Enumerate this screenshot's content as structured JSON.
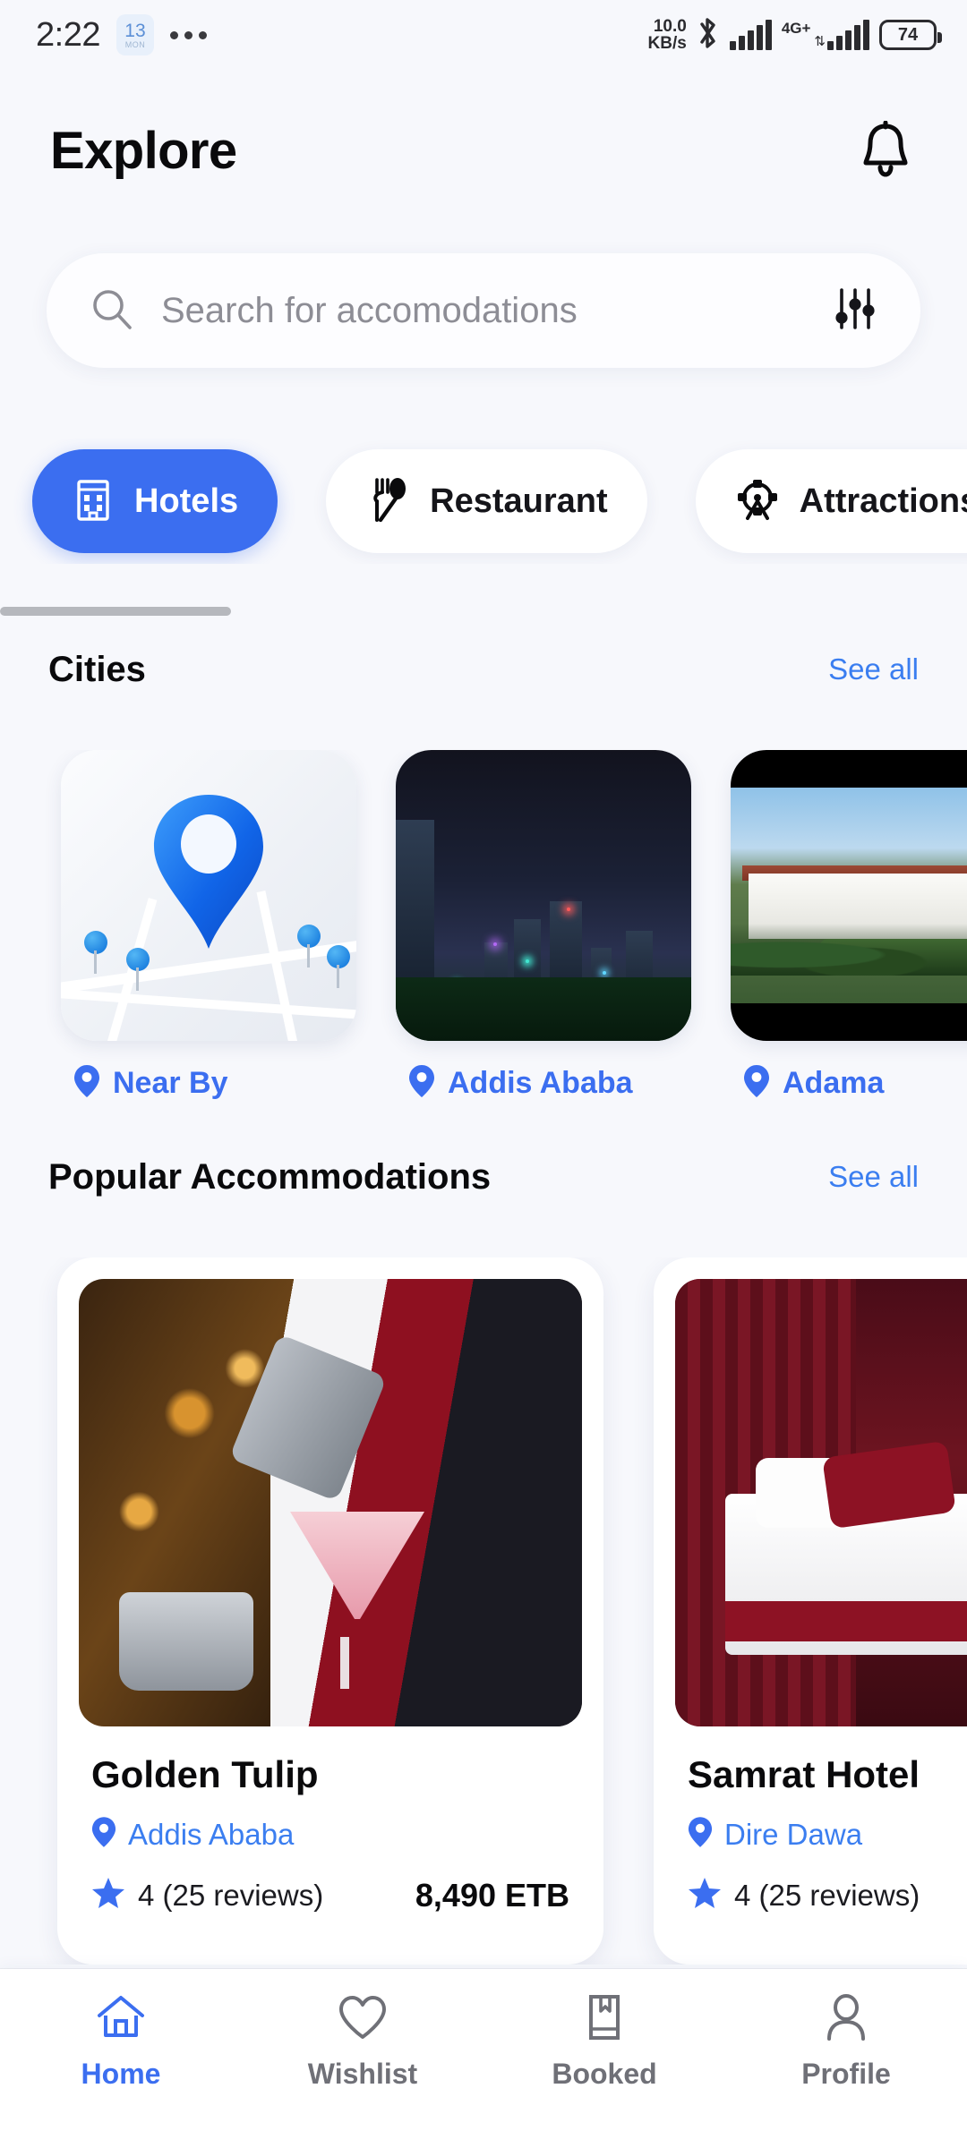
{
  "statusbar": {
    "time": "2:22",
    "calendar_day": "13",
    "calendar_weekday": "MON",
    "network_speed": "10.0",
    "network_speed_unit": "KB/s",
    "network_type": "4G+",
    "battery_level": "74",
    "bluetooth_icon": "bluetooth-icon",
    "more_icon": "more-dots-icon"
  },
  "header": {
    "title": "Explore",
    "notification_icon": "bell-icon"
  },
  "search": {
    "placeholder": "Search for accomodations",
    "value": "",
    "search_icon": "search-icon",
    "filter_icon": "filter-sliders-icon"
  },
  "categories": [
    {
      "label": "Hotels",
      "icon": "hotel-building-icon",
      "active": true
    },
    {
      "label": "Restaurant",
      "icon": "fork-spoon-icon",
      "active": false
    },
    {
      "label": "Attractions",
      "icon": "ferris-wheel-icon",
      "active": false
    }
  ],
  "cities_section": {
    "title": "Cities",
    "see_all": "See all",
    "items": [
      {
        "name": "Near By",
        "image": "map-with-pin-thumbnail",
        "pin_icon": "location-pin-icon"
      },
      {
        "name": "Addis Ababa",
        "image": "night-city-skyline-thumbnail",
        "pin_icon": "location-pin-icon"
      },
      {
        "name": "Adama",
        "image": "hotel-aerial-view-thumbnail",
        "pin_icon": "location-pin-icon"
      }
    ]
  },
  "popular_section": {
    "title": "Popular Accommodations",
    "see_all": "See all",
    "items": [
      {
        "name": "Golden Tulip",
        "city": "Addis Ababa",
        "rating": "4 (25 reviews)",
        "price": "8,490 ETB",
        "image": "bartender-pouring-cocktail-photo",
        "pin_icon": "location-pin-icon",
        "star_icon": "star-icon"
      },
      {
        "name": "Samrat Hotel",
        "city": "Dire Dawa",
        "rating": "4 (25 reviews)",
        "price": "",
        "image": "hotel-bedroom-photo",
        "pin_icon": "location-pin-icon",
        "star_icon": "star-icon"
      }
    ]
  },
  "bottom_nav": [
    {
      "label": "Home",
      "icon": "home-icon",
      "active": true
    },
    {
      "label": "Wishlist",
      "icon": "heart-icon",
      "active": false
    },
    {
      "label": "Booked",
      "icon": "bookmark-book-icon",
      "active": false
    },
    {
      "label": "Profile",
      "icon": "person-icon",
      "active": false
    }
  ],
  "colors": {
    "accent": "#3b6ef0",
    "link": "#3b7ef0",
    "background": "#f7f8fc",
    "card": "#ffffff",
    "text": "#0a0a0c",
    "muted": "#6f7077"
  }
}
